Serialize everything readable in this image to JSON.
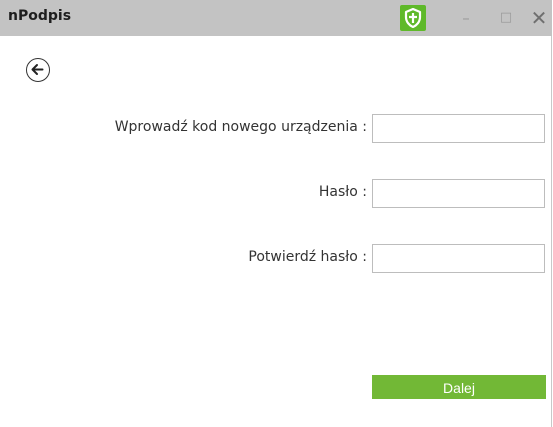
{
  "window": {
    "title": "nPodpis"
  },
  "icons": {
    "shield": "shield-icon",
    "back": "arrow-left-icon",
    "minimize": "minimize-icon",
    "maximize": "maximize-icon",
    "close": "close-icon"
  },
  "titlebar_buttons": {
    "minimize": "–",
    "maximize": "□",
    "close": "✕"
  },
  "form": {
    "device_code_label": "Wprowadź kod nowego urządzenia :",
    "device_code_value": "",
    "password_label": "Hasło :",
    "password_value": "",
    "confirm_password_label": "Potwierdź hasło :",
    "confirm_password_value": ""
  },
  "actions": {
    "next_label": "Dalej"
  },
  "colors": {
    "titlebar": "#c3c3c3",
    "accent_green": "#72b836",
    "shield_green": "#5fb92a"
  }
}
